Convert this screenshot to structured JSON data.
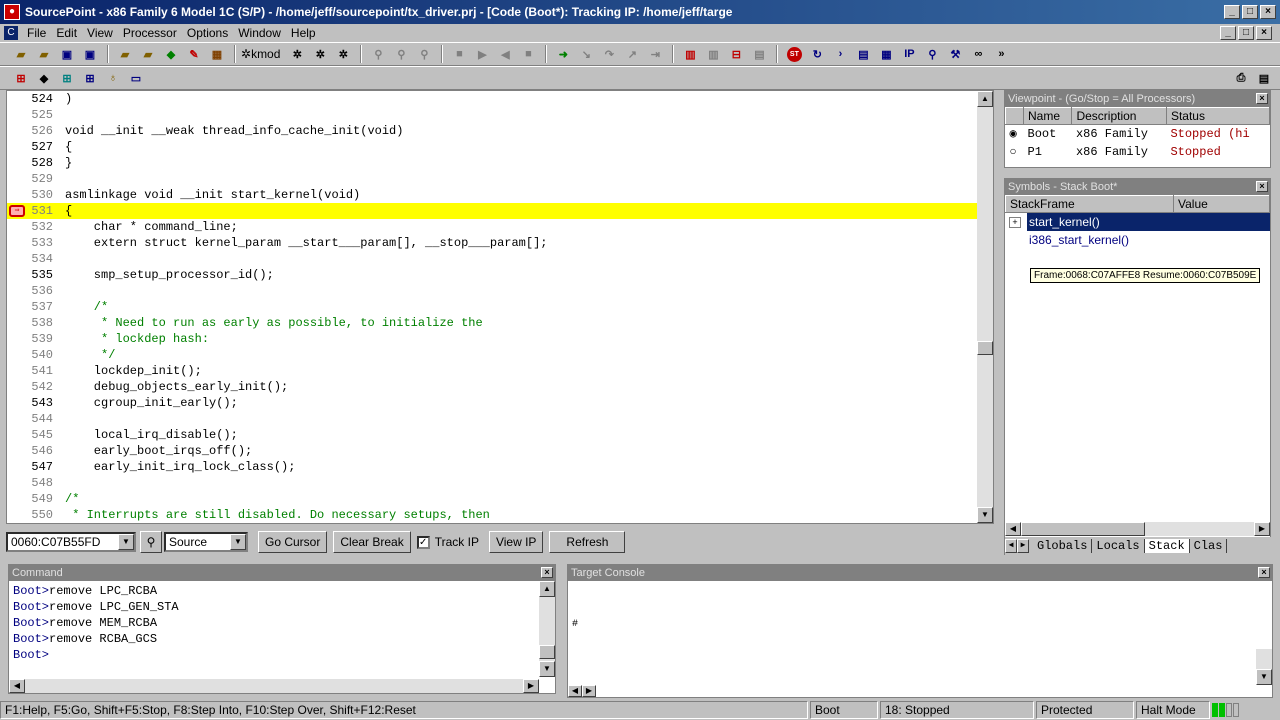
{
  "window": {
    "title": "SourcePoint - x86 Family 6 Model 1C (S/P) - /home/jeff/sourcepoint/tx_driver.prj - [Code (Boot*): Tracking IP: /home/jeff/targe",
    "min": "_",
    "max": "□",
    "close": "×"
  },
  "menu": [
    "File",
    "Edit",
    "View",
    "Processor",
    "Options",
    "Window",
    "Help"
  ],
  "mdi": {
    "min": "_",
    "max": "□",
    "close": "×"
  },
  "toolbar": {
    "kmod": "kmod",
    "ip_label": "IP"
  },
  "code": {
    "lines": [
      {
        "n": "524",
        "t": ")",
        "dim": false
      },
      {
        "n": "525",
        "t": "",
        "dim": true
      },
      {
        "n": "526",
        "t": "void __init __weak thread_info_cache_init(void)",
        "dim": true
      },
      {
        "n": "527",
        "t": "{",
        "dim": false
      },
      {
        "n": "528",
        "t": "}",
        "dim": false
      },
      {
        "n": "529",
        "t": "",
        "dim": true
      },
      {
        "n": "530",
        "t": "asmlinkage void __init start_kernel(void)",
        "dim": true
      },
      {
        "n": "531",
        "t": "{",
        "dim": true,
        "hl": true,
        "bp": true
      },
      {
        "n": "532",
        "t": "    char * command_line;",
        "dim": true
      },
      {
        "n": "533",
        "t": "    extern struct kernel_param __start___param[], __stop___param[];",
        "dim": true
      },
      {
        "n": "534",
        "t": "",
        "dim": true
      },
      {
        "n": "535",
        "t": "    smp_setup_processor_id();",
        "dim": false
      },
      {
        "n": "536",
        "t": "",
        "dim": true
      },
      {
        "n": "537",
        "t": "    /*",
        "dim": true,
        "cm": true
      },
      {
        "n": "538",
        "t": "     * Need to run as early as possible, to initialize the",
        "dim": true,
        "cm": true
      },
      {
        "n": "539",
        "t": "     * lockdep hash:",
        "dim": true,
        "cm": true
      },
      {
        "n": "540",
        "t": "     */",
        "dim": true,
        "cm": true
      },
      {
        "n": "541",
        "t": "    lockdep_init();",
        "dim": true
      },
      {
        "n": "542",
        "t": "    debug_objects_early_init();",
        "dim": true
      },
      {
        "n": "543",
        "t": "    cgroup_init_early();",
        "dim": false
      },
      {
        "n": "544",
        "t": "",
        "dim": true
      },
      {
        "n": "545",
        "t": "    local_irq_disable();",
        "dim": true
      },
      {
        "n": "546",
        "t": "    early_boot_irqs_off();",
        "dim": true
      },
      {
        "n": "547",
        "t": "    early_init_irq_lock_class();",
        "dim": false
      },
      {
        "n": "548",
        "t": "",
        "dim": true
      },
      {
        "n": "549",
        "t": "/*",
        "dim": true,
        "cm": true
      },
      {
        "n": "550",
        "t": " * Interrupts are still disabled. Do necessary setups, then",
        "dim": true,
        "cm": true
      }
    ]
  },
  "codebar": {
    "address": "0060:C07B55FD",
    "mode": "Source",
    "go_cursor": "Go Cursor",
    "clear_break": "Clear Break",
    "track_ip": "Track IP",
    "view_ip": "View IP",
    "refresh": "Refresh"
  },
  "viewpoint": {
    "title": "Viewpoint - (Go/Stop = All Processors)",
    "headers": [
      "Name",
      "Description",
      "Status"
    ],
    "rows": [
      {
        "name": "Boot",
        "desc": "x86 Family",
        "status": "Stopped (hi",
        "selected": true
      },
      {
        "name": "P1",
        "desc": "x86 Family",
        "status": "Stopped",
        "selected": false
      }
    ]
  },
  "symbols": {
    "title": "Symbols - Stack Boot*",
    "headers": [
      "StackFrame",
      "Value"
    ],
    "frames": [
      "start_kernel()",
      "i386_start_kernel()"
    ],
    "tooltip": "Frame:0068:C07AFFE8 Resume:0060:C07B509E",
    "tabs": [
      "Globals",
      "Locals",
      "Stack",
      "Clas"
    ]
  },
  "command": {
    "title": "Command",
    "prompt": "Boot>",
    "lines": [
      "remove LPC_RCBA",
      "remove LPC_GEN_STA",
      "remove MEM_RCBA",
      "remove RCBA_GCS",
      ""
    ]
  },
  "console": {
    "title": "Target Console",
    "text": "#"
  },
  "status": {
    "help": "F1:Help, F5:Go, Shift+F5:Stop, F8:Step Into, F10:Step Over, Shift+F12:Reset",
    "proc": "Boot",
    "state": "18: Stopped",
    "mode": "Protected",
    "halt": "Halt Mode"
  },
  "colors": {
    "highlight": "#ffff00",
    "title": "#0a246a",
    "selection": "#0a246a",
    "status_green": "#00c000"
  }
}
